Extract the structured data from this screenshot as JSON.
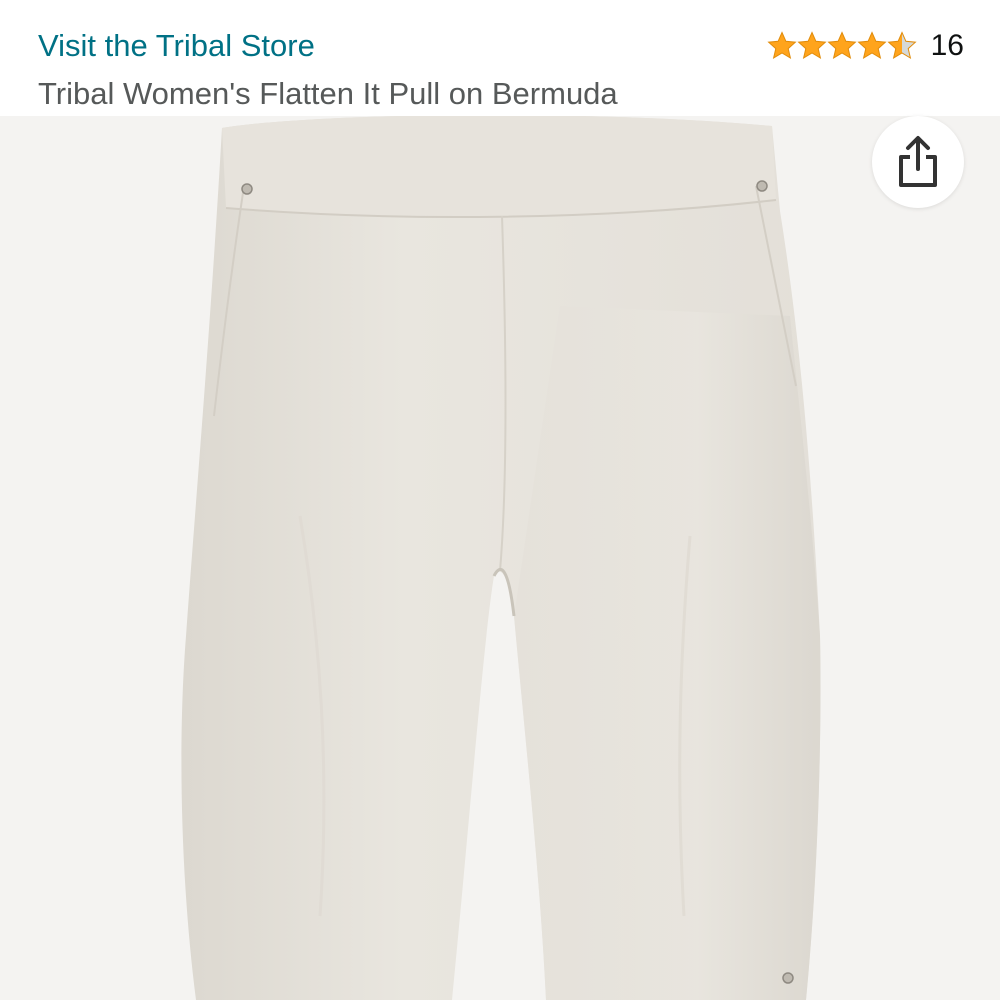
{
  "header": {
    "store_link": "Visit the Tribal Store",
    "product_title": "Tribal Women's Flatten It Pull on Bermuda"
  },
  "rating": {
    "stars": 4.5,
    "max_stars": 5,
    "review_count": "16",
    "star_color": "#FFA41C",
    "empty_star_color": "#D5D9D9"
  },
  "image": {
    "alt": "Tribal Women's Flatten It Pull on Bermuda",
    "background_color": "#F4F3F1",
    "garment_color": "#E6E2DB"
  },
  "share": {
    "icon": "share-icon"
  },
  "colors": {
    "link": "#007185",
    "title": "#565959",
    "text": "#0F1111"
  }
}
